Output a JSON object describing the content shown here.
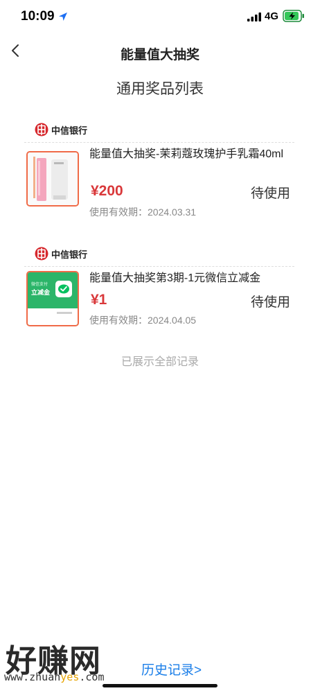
{
  "status_bar": {
    "time": "10:09",
    "network": "4G"
  },
  "nav": {
    "title": "能量值大抽奖"
  },
  "page": {
    "subtitle": "通用奖品列表",
    "end_note": "已展示全部记录"
  },
  "prizes": [
    {
      "bank_name": "中信银行",
      "title": "能量值大抽奖-茉莉蔻玫瑰护手乳霜40ml",
      "price": "¥200",
      "status": "待使用",
      "expiry": "使用有效期：2024.03.31",
      "thumb_icon": "hand-cream-tube-icon"
    },
    {
      "bank_name": "中信银行",
      "title": "能量值大抽奖第3期-1元微信立减金",
      "price": "¥1",
      "status": "待使用",
      "expiry": "使用有效期：2024.04.05",
      "thumb_icon": "wechat-pay-coupon-icon",
      "thumb_label_top": "微信支付",
      "thumb_label_main": "立减金"
    }
  ],
  "watermark": {
    "brand": "好赚网",
    "url_part1": "www.zhuan",
    "url_accent": "yes",
    "url_part2": ".com"
  },
  "footer": {
    "history_link": "历史记录>"
  },
  "colors": {
    "price_red": "#d9383a",
    "card_border": "#f06a47",
    "link_blue": "#1a7ee8",
    "bank_red": "#d6282d",
    "wechat_green": "#07c160"
  }
}
